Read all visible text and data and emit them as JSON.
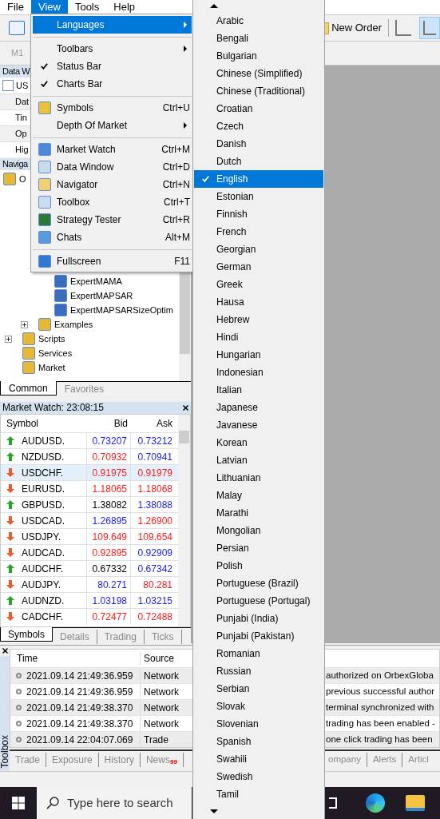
{
  "menu_bar": [
    {
      "label": "File",
      "selected": false
    },
    {
      "label": "View",
      "selected": true
    },
    {
      "label": "Tools",
      "selected": false
    },
    {
      "label": "Help",
      "selected": false
    }
  ],
  "toolbar": {
    "new_order": "New Order",
    "timeframe": "M1"
  },
  "data_window": {
    "title": "Data W",
    "symbol": "US",
    "rows": [
      "Dat",
      "Tin",
      "Op",
      "Hig"
    ]
  },
  "navigator": {
    "title": "Naviga",
    "tree": [
      {
        "label": "O",
        "children": [
          {
            "children": [
              {
                "children": [
                  {
                    "label": "ExpertMAMA"
                  },
                  {
                    "label": "ExpertMAPSAR"
                  },
                  {
                    "label": "ExpertMAPSARSizeOptim"
                  }
                ]
              },
              {
                "label": "Examples",
                "expanded": false
              }
            ]
          },
          {
            "label": "Scripts",
            "expanded": false
          },
          {
            "label": "Services"
          },
          {
            "label": "Market"
          }
        ]
      }
    ],
    "tabs": [
      {
        "label": "Common",
        "selected": true
      },
      {
        "label": "Favorites",
        "selected": false
      }
    ]
  },
  "market_watch": {
    "title": "Market Watch: 23:08:15",
    "columns": [
      "Symbol",
      "Bid",
      "Ask"
    ],
    "rows": [
      {
        "symbol": "AUDUSD.",
        "up": true,
        "bid": {
          "value": "0.73207",
          "color": "#1a1aff"
        },
        "ask": {
          "value": "0.73212",
          "color": "#1a1aff"
        },
        "selected": false
      },
      {
        "symbol": "NZDUSD.",
        "up": true,
        "bid": {
          "value": "0.70932",
          "color": "#ff1a1a"
        },
        "ask": {
          "value": "0.70941",
          "color": "#1a1aff"
        },
        "selected": false
      },
      {
        "symbol": "USDCHF.",
        "up": false,
        "bid": {
          "value": "0.91975",
          "color": "#ff1a1a"
        },
        "ask": {
          "value": "0.91979",
          "color": "#ff1a1a"
        },
        "selected": true
      },
      {
        "symbol": "EURUSD.",
        "up": false,
        "bid": {
          "value": "1.18065",
          "color": "#ff1a1a"
        },
        "ask": {
          "value": "1.18068",
          "color": "#ff1a1a"
        },
        "selected": false
      },
      {
        "symbol": "GBPUSD.",
        "up": true,
        "bid": {
          "value": "1.38082",
          "color": "#000000"
        },
        "ask": {
          "value": "1.38088",
          "color": "#1a1aff"
        },
        "selected": false
      },
      {
        "symbol": "USDCAD.",
        "up": false,
        "bid": {
          "value": "1.26895",
          "color": "#1a1aff"
        },
        "ask": {
          "value": "1.26900",
          "color": "#ff1a1a"
        },
        "selected": false
      },
      {
        "symbol": "USDJPY.",
        "up": false,
        "bid": {
          "value": "109.649",
          "color": "#ff1a1a"
        },
        "ask": {
          "value": "109.654",
          "color": "#ff1a1a"
        },
        "selected": false
      },
      {
        "symbol": "AUDCAD.",
        "up": false,
        "bid": {
          "value": "0.92895",
          "color": "#ff1a1a"
        },
        "ask": {
          "value": "0.92909",
          "color": "#1a1aff"
        },
        "selected": false
      },
      {
        "symbol": "AUDCHF.",
        "up": true,
        "bid": {
          "value": "0.67332",
          "color": "#000000"
        },
        "ask": {
          "value": "0.67342",
          "color": "#1a1aff"
        },
        "selected": false
      },
      {
        "symbol": "AUDJPY.",
        "up": false,
        "bid": {
          "value": "80.271",
          "color": "#1a1aff"
        },
        "ask": {
          "value": "80.281",
          "color": "#ff1a1a"
        },
        "selected": false
      },
      {
        "symbol": "AUDNZD.",
        "up": true,
        "bid": {
          "value": "1.03198",
          "color": "#1a1aff"
        },
        "ask": {
          "value": "1.03215",
          "color": "#1a1aff"
        },
        "selected": false
      },
      {
        "symbol": "CADCHF.",
        "up": false,
        "bid": {
          "value": "0.72477",
          "color": "#ff1a1a"
        },
        "ask": {
          "value": "0.72488",
          "color": "#ff1a1a"
        },
        "selected": false
      }
    ],
    "tabs": [
      {
        "label": "Symbols",
        "selected": true
      },
      {
        "label": "Details",
        "selected": false
      },
      {
        "label": "Trading",
        "selected": false
      },
      {
        "label": "Ticks",
        "selected": false
      }
    ]
  },
  "toolbox": {
    "label": "Toolbox",
    "columns": [
      "Time",
      "Source"
    ],
    "rows": [
      {
        "time": "2021.09.14 21:49:36.959",
        "source": "Network",
        "message": "authorized on OrbexGloba"
      },
      {
        "time": "2021.09.14 21:49:36.959",
        "source": "Network",
        "message": "previous successful author"
      },
      {
        "time": "2021.09.14 21:49:38.370",
        "source": "Network",
        "message": "terminal synchronized with"
      },
      {
        "time": "2021.09.14 21:49:38.370",
        "source": "Network",
        "message": "trading has been enabled -"
      },
      {
        "time": "2021.09.14 22:04:07.069",
        "source": "Trade",
        "message": "one click trading has been"
      }
    ],
    "tabs_left": [
      {
        "label": "Trade"
      },
      {
        "label": "Exposure"
      },
      {
        "label": "History"
      },
      {
        "label": "News",
        "badge": "99"
      }
    ],
    "tabs_right": [
      {
        "label": "ompany"
      },
      {
        "label": "Alerts"
      },
      {
        "label": "Articl"
      }
    ]
  },
  "view_menu": {
    "items": [
      {
        "kind": "item",
        "label": "Languages",
        "selected": true,
        "checked": false,
        "submenu": true
      },
      {
        "kind": "separator"
      },
      {
        "kind": "item",
        "label": "Toolbars",
        "selected": false,
        "checked": false,
        "submenu": true
      },
      {
        "kind": "item",
        "label": "Status Bar",
        "selected": false,
        "checked": true,
        "submenu": false
      },
      {
        "kind": "item",
        "label": "Charts Bar",
        "selected": false,
        "checked": true,
        "submenu": false
      },
      {
        "kind": "separator"
      },
      {
        "kind": "item",
        "label": "Symbols",
        "shortcut": "Ctrl+U",
        "selected": false,
        "checked": false,
        "submenu": false
      },
      {
        "kind": "item",
        "label": "Depth Of Market",
        "selected": false,
        "checked": false,
        "submenu": true
      },
      {
        "kind": "separator"
      },
      {
        "kind": "item",
        "label": "Market Watch",
        "shortcut": "Ctrl+M",
        "selected": false,
        "checked": false,
        "submenu": false
      },
      {
        "kind": "item",
        "label": "Data Window",
        "shortcut": "Ctrl+D",
        "selected": false,
        "checked": false,
        "submenu": false
      },
      {
        "kind": "item",
        "label": "Navigator",
        "shortcut": "Ctrl+N",
        "selected": false,
        "checked": false,
        "submenu": false
      },
      {
        "kind": "item",
        "label": "Toolbox",
        "shortcut": "Ctrl+T",
        "selected": false,
        "checked": false,
        "submenu": false
      },
      {
        "kind": "item",
        "label": "Strategy Tester",
        "shortcut": "Ctrl+R",
        "selected": false,
        "checked": false,
        "submenu": false
      },
      {
        "kind": "item",
        "label": "Chats",
        "shortcut": "Alt+M",
        "selected": false,
        "checked": false,
        "submenu": false
      },
      {
        "kind": "separator"
      },
      {
        "kind": "item",
        "label": "Fullscreen",
        "shortcut": "F11",
        "selected": false,
        "checked": false,
        "submenu": false
      }
    ]
  },
  "languages_menu": {
    "items": [
      {
        "label": "Arabic",
        "selected": false
      },
      {
        "label": "Bengali",
        "selected": false
      },
      {
        "label": "Bulgarian",
        "selected": false
      },
      {
        "label": "Chinese (Simplified)",
        "selected": false
      },
      {
        "label": "Chinese (Traditional)",
        "selected": false
      },
      {
        "label": "Croatian",
        "selected": false
      },
      {
        "label": "Czech",
        "selected": false
      },
      {
        "label": "Danish",
        "selected": false
      },
      {
        "label": "Dutch",
        "selected": false
      },
      {
        "label": "English",
        "selected": true
      },
      {
        "label": "Estonian",
        "selected": false
      },
      {
        "label": "Finnish",
        "selected": false
      },
      {
        "label": "French",
        "selected": false
      },
      {
        "label": "Georgian",
        "selected": false
      },
      {
        "label": "German",
        "selected": false
      },
      {
        "label": "Greek",
        "selected": false
      },
      {
        "label": "Hausa",
        "selected": false
      },
      {
        "label": "Hebrew",
        "selected": false
      },
      {
        "label": "Hindi",
        "selected": false
      },
      {
        "label": "Hungarian",
        "selected": false
      },
      {
        "label": "Indonesian",
        "selected": false
      },
      {
        "label": "Italian",
        "selected": false
      },
      {
        "label": "Japanese",
        "selected": false
      },
      {
        "label": "Javanese",
        "selected": false
      },
      {
        "label": "Korean",
        "selected": false
      },
      {
        "label": "Latvian",
        "selected": false
      },
      {
        "label": "Lithuanian",
        "selected": false
      },
      {
        "label": "Malay",
        "selected": false
      },
      {
        "label": "Marathi",
        "selected": false
      },
      {
        "label": "Mongolian",
        "selected": false
      },
      {
        "label": "Persian",
        "selected": false
      },
      {
        "label": "Polish",
        "selected": false
      },
      {
        "label": "Portuguese (Brazil)",
        "selected": false
      },
      {
        "label": "Portuguese (Portugal)",
        "selected": false
      },
      {
        "label": "Punjabi (India)",
        "selected": false
      },
      {
        "label": "Punjabi (Pakistan)",
        "selected": false
      },
      {
        "label": "Romanian",
        "selected": false
      },
      {
        "label": "Russian",
        "selected": false
      },
      {
        "label": "Serbian",
        "selected": false
      },
      {
        "label": "Slovak",
        "selected": false
      },
      {
        "label": "Slovenian",
        "selected": false
      },
      {
        "label": "Spanish",
        "selected": false
      },
      {
        "label": "Swahili",
        "selected": false
      },
      {
        "label": "Swedish",
        "selected": false
      },
      {
        "label": "Tamil",
        "selected": false
      }
    ]
  },
  "taskbar": {
    "search_placeholder": "Type here to search"
  }
}
